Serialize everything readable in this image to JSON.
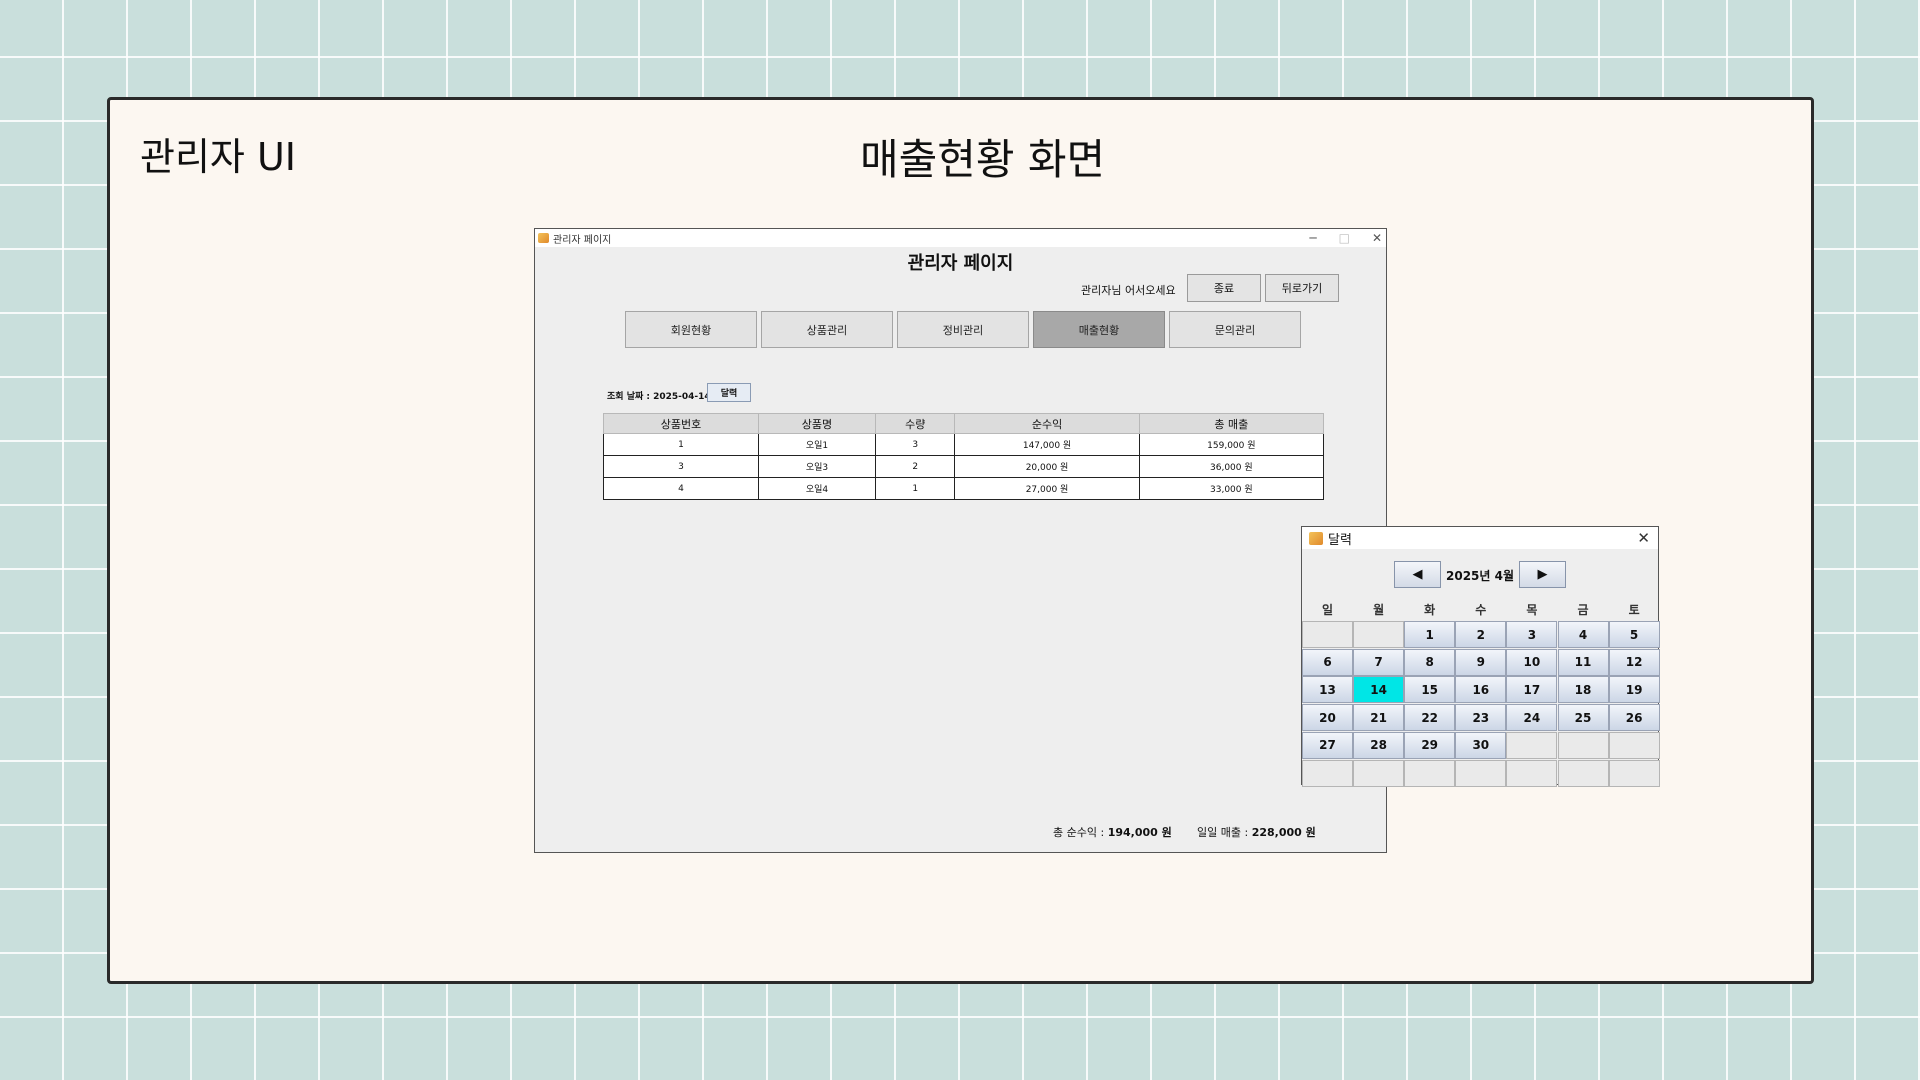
{
  "slide": {
    "label": "관리자 UI",
    "title": "매출현황 화면"
  },
  "window": {
    "title": "관리자 페이지",
    "controls": {
      "minimize": "─",
      "maximize": "□",
      "close": "✕"
    },
    "heading": "관리자 페이지",
    "welcome": "관리자님 어서오세요",
    "exit_label": "종료",
    "back_label": "뒤로가기",
    "tabs": [
      {
        "label": "회원현황",
        "active": false
      },
      {
        "label": "상품관리",
        "active": false
      },
      {
        "label": "정비관리",
        "active": false
      },
      {
        "label": "매출현황",
        "active": true
      },
      {
        "label": "문의관리",
        "active": false
      }
    ],
    "date_label": "조회 날짜 :  2025-04-14",
    "calendar_button": "달력",
    "table": {
      "headers": [
        "상품번호",
        "상품명",
        "수량",
        "순수익",
        "총 매출"
      ],
      "rows": [
        [
          "1",
          "오일1",
          "3",
          "147,000 원",
          "159,000 원"
        ],
        [
          "3",
          "오일3",
          "2",
          "20,000 원",
          "36,000 원"
        ],
        [
          "4",
          "오일4",
          "1",
          "27,000 원",
          "33,000 원"
        ]
      ]
    },
    "summary": {
      "profit_label": "총 순수익 : ",
      "profit_value": "194,000 원",
      "sales_label": "일일 매출 : ",
      "sales_value": "228,000 원"
    }
  },
  "calendar": {
    "title": "달력",
    "close": "✕",
    "prev": "◀",
    "next": "▶",
    "month": "2025년 4월",
    "weekdays": [
      "일",
      "월",
      "화",
      "수",
      "목",
      "금",
      "토"
    ],
    "weeks": [
      [
        "",
        "",
        "1",
        "2",
        "3",
        "4",
        "5"
      ],
      [
        "6",
        "7",
        "8",
        "9",
        "10",
        "11",
        "12"
      ],
      [
        "13",
        "14",
        "15",
        "16",
        "17",
        "18",
        "19"
      ],
      [
        "20",
        "21",
        "22",
        "23",
        "24",
        "25",
        "26"
      ],
      [
        "27",
        "28",
        "29",
        "30",
        "",
        "",
        ""
      ],
      [
        "",
        "",
        "",
        "",
        "",
        "",
        ""
      ]
    ],
    "selected_day": "14",
    "selected_color": "#00e6e6"
  }
}
